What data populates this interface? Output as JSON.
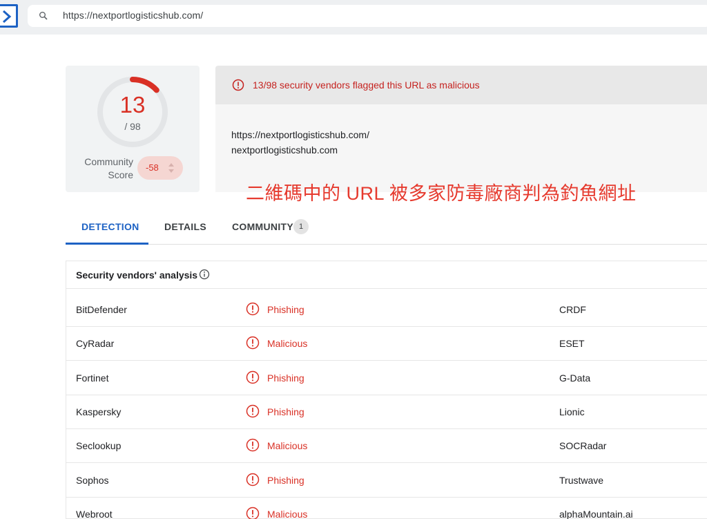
{
  "address_bar": {
    "url": "https://nextportlogisticshub.com/"
  },
  "score": {
    "detections": "13",
    "total": "/ 98",
    "community_label_line1": "Community",
    "community_label_line2": "Score",
    "community_value": "-58",
    "detection_ratio": 0.1327
  },
  "alert": {
    "text": "13/98 security vendors flagged this URL as malicious"
  },
  "target": {
    "url": "https://nextportlogisticshub.com/",
    "domain": "nextportlogisticshub.com"
  },
  "caption": "二維碼中的 URL 被多家防毒廠商判為釣魚網址",
  "tabs": [
    {
      "label": "DETECTION"
    },
    {
      "label": "DETAILS"
    },
    {
      "label": "COMMUNITY"
    }
  ],
  "community_badge": "1",
  "analysis": {
    "title": "Security vendors' analysis",
    "rows": [
      {
        "vendor": "BitDefender",
        "result": "Phishing",
        "vendor2": "CRDF"
      },
      {
        "vendor": "CyRadar",
        "result": "Malicious",
        "vendor2": "ESET"
      },
      {
        "vendor": "Fortinet",
        "result": "Phishing",
        "vendor2": "G-Data"
      },
      {
        "vendor": "Kaspersky",
        "result": "Phishing",
        "vendor2": "Lionic"
      },
      {
        "vendor": "Seclookup",
        "result": "Malicious",
        "vendor2": "SOCRadar"
      },
      {
        "vendor": "Sophos",
        "result": "Phishing",
        "vendor2": "Trustwave"
      },
      {
        "vendor": "Webroot",
        "result": "Malicious",
        "vendor2": "alphaMountain.ai"
      }
    ]
  },
  "colors": {
    "accent": "#1d62c4",
    "malicious": "#d93025",
    "caption": "#e63a2e"
  },
  "icons": {
    "menu": "chevron-right-icon",
    "search": "search-icon",
    "alert": "exclamation-circle-icon",
    "info": "info-icon",
    "stepper": "up-down-arrows-icon"
  }
}
